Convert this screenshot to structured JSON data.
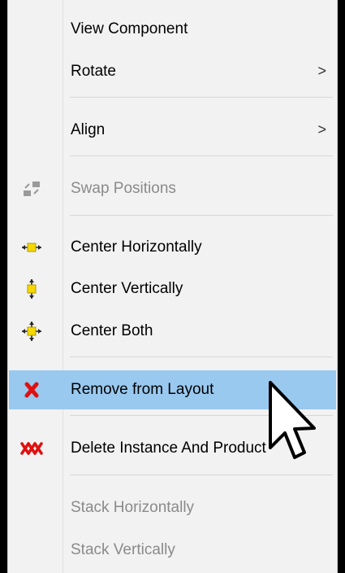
{
  "menu": {
    "items": [
      {
        "label": "View Component",
        "submenu": false,
        "disabled": false,
        "icon": null
      },
      {
        "label": "Rotate",
        "submenu": true,
        "disabled": false,
        "icon": null
      },
      {
        "label": "Align",
        "submenu": true,
        "disabled": false,
        "icon": null
      },
      {
        "label": "Swap Positions",
        "submenu": false,
        "disabled": true,
        "icon": "swap-positions-icon"
      },
      {
        "label": "Center Horizontally",
        "submenu": false,
        "disabled": false,
        "icon": "center-horizontally-icon"
      },
      {
        "label": "Center Vertically",
        "submenu": false,
        "disabled": false,
        "icon": "center-vertically-icon"
      },
      {
        "label": "Center Both",
        "submenu": false,
        "disabled": false,
        "icon": "center-both-icon"
      },
      {
        "label": "Remove from Layout",
        "submenu": false,
        "disabled": false,
        "highlighted": true,
        "icon": "red-x-icon"
      },
      {
        "label": "Delete Instance And Product",
        "submenu": false,
        "disabled": false,
        "icon": "red-triple-x-icon"
      },
      {
        "label": "Stack Horizontally",
        "submenu": false,
        "disabled": true,
        "icon": null
      },
      {
        "label": "Stack Vertically",
        "submenu": false,
        "disabled": true,
        "icon": null
      }
    ],
    "submenu_glyph": ">"
  },
  "colors": {
    "highlight": "#99c9ef",
    "menu_background": "#f2f2f2",
    "disabled_text": "#8a8a8a",
    "icon_yellow": "#f5d800",
    "icon_red": "#e01010"
  }
}
